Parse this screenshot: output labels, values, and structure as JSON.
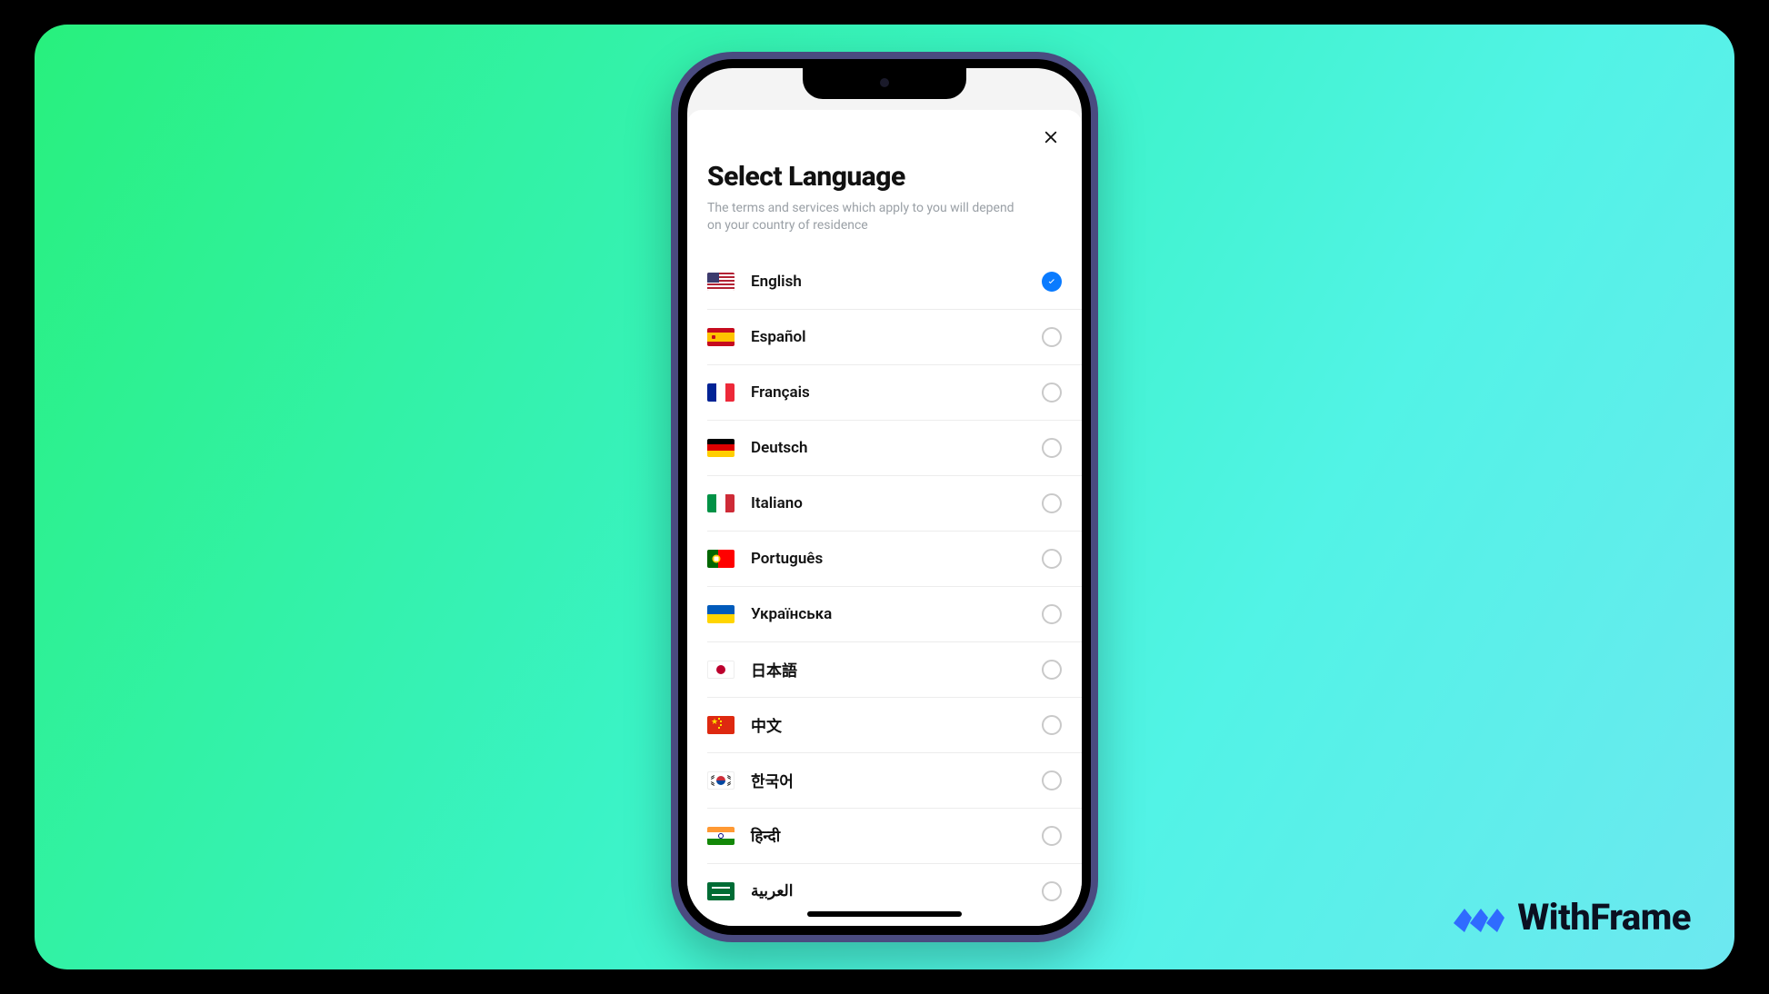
{
  "brand": {
    "name": "WithFrame"
  },
  "sheet": {
    "title": "Select Language",
    "subtitle": "The terms and services which apply to you will depend on your country of residence"
  },
  "languages": [
    {
      "code": "us",
      "label": "English",
      "selected": true
    },
    {
      "code": "es",
      "label": "Español",
      "selected": false
    },
    {
      "code": "fr",
      "label": "Français",
      "selected": false
    },
    {
      "code": "de",
      "label": "Deutsch",
      "selected": false
    },
    {
      "code": "it",
      "label": "Italiano",
      "selected": false
    },
    {
      "code": "pt",
      "label": "Português",
      "selected": false
    },
    {
      "code": "ua",
      "label": "Українська",
      "selected": false
    },
    {
      "code": "jp",
      "label": "日本語",
      "selected": false
    },
    {
      "code": "cn",
      "label": "中文",
      "selected": false
    },
    {
      "code": "kr",
      "label": "한국어",
      "selected": false
    },
    {
      "code": "in",
      "label": "हिन्दी",
      "selected": false
    },
    {
      "code": "sa",
      "label": "العربية",
      "selected": false
    }
  ],
  "colors": {
    "accent": "#0a7bff",
    "gradient_start": "#28f07d",
    "gradient_end": "#6de8f0"
  }
}
